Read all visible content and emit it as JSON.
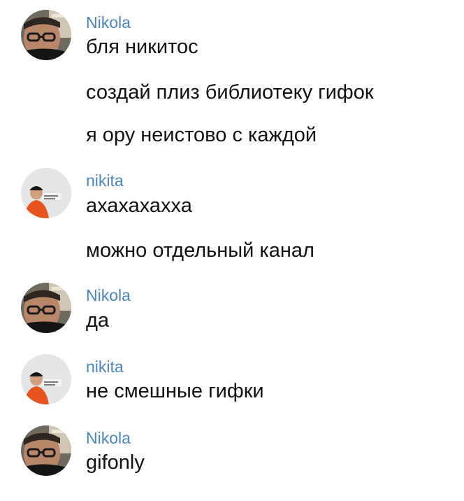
{
  "messages": [
    {
      "sender": "Nikola",
      "avatar_icon": "nikola-avatar",
      "lines": [
        "бля никитос",
        "создай плиз библиотеку гифок",
        "я ору неистово с каждой"
      ]
    },
    {
      "sender": "nikita",
      "avatar_icon": "nikita-avatar",
      "lines": [
        "ахахахахха",
        "можно отдельный канал"
      ]
    },
    {
      "sender": "Nikola",
      "avatar_icon": "nikola-avatar",
      "lines": [
        "да"
      ]
    },
    {
      "sender": "nikita",
      "avatar_icon": "nikita-avatar",
      "lines": [
        "не смешные гифки"
      ]
    },
    {
      "sender": "Nikola",
      "avatar_icon": "nikola-avatar",
      "lines": [
        "gifonly"
      ]
    }
  ],
  "colors": {
    "sender_name": "#4a86c0",
    "message_text": "#111111",
    "background": "#ffffff"
  }
}
